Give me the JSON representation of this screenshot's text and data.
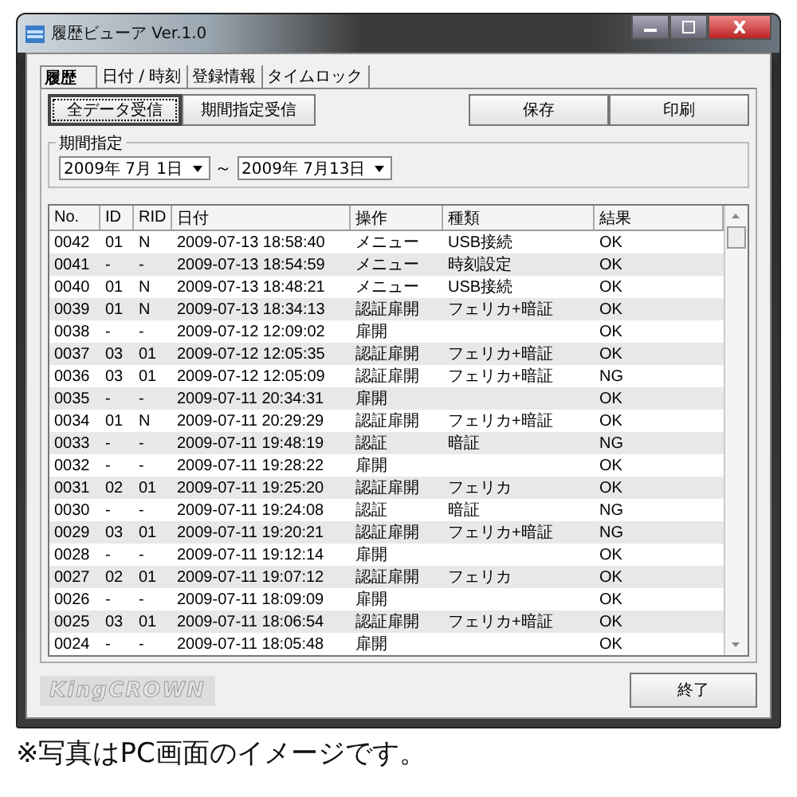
{
  "window": {
    "title": "履歴ビューア Ver.1.0"
  },
  "tabs": [
    {
      "label": "履歴",
      "selected": true
    },
    {
      "label": "日付 / 時刻",
      "selected": false
    },
    {
      "label": "登録情報",
      "selected": false
    },
    {
      "label": "タイムロック",
      "selected": false
    }
  ],
  "buttons": [
    {
      "label": "全データ受信",
      "selected": true
    },
    {
      "label": "期間指定受信",
      "selected": false
    },
    {
      "label": "保存",
      "selected": false
    },
    {
      "label": "印刷",
      "selected": false
    }
  ],
  "period": {
    "label": "期間指定",
    "from": "2009年 7月 1日",
    "separator": "～",
    "to": "2009年 7月13日"
  },
  "table": {
    "columns": [
      "No.",
      "ID",
      "RID",
      "日付",
      "操作",
      "種類",
      "結果"
    ],
    "rows": [
      {
        "no": "0042",
        "id": "01",
        "rid": "N",
        "date": "2009-07-13 18:58:40",
        "op": "メニュー",
        "type": "USB接続",
        "result": "OK"
      },
      {
        "no": "0041",
        "id": "-",
        "rid": "-",
        "date": "2009-07-13 18:54:59",
        "op": "メニュー",
        "type": "時刻設定",
        "result": "OK"
      },
      {
        "no": "0040",
        "id": "01",
        "rid": "N",
        "date": "2009-07-13 18:48:21",
        "op": "メニュー",
        "type": "USB接続",
        "result": "OK"
      },
      {
        "no": "0039",
        "id": "01",
        "rid": "N",
        "date": "2009-07-13 18:34:13",
        "op": "認証扉開",
        "type": "フェリカ+暗証",
        "result": "OK"
      },
      {
        "no": "0038",
        "id": "-",
        "rid": "-",
        "date": "2009-07-12 12:09:02",
        "op": "扉開",
        "result": "OK"
      },
      {
        "no": "0037",
        "id": "03",
        "rid": "01",
        "date": "2009-07-12 12:05:35",
        "op": "認証扉開",
        "type": "フェリカ+暗証",
        "result": "OK"
      },
      {
        "no": "0036",
        "id": "03",
        "rid": "01",
        "date": "2009-07-12 12:05:09",
        "op": "認証扉開",
        "type": "フェリカ+暗証",
        "result": "NG"
      },
      {
        "no": "0035",
        "id": "-",
        "rid": "-",
        "date": "2009-07-11 20:34:31",
        "op": "扉開",
        "result": "OK"
      },
      {
        "no": "0034",
        "id": "01",
        "rid": "N",
        "date": "2009-07-11 20:29:29",
        "op": "認証扉開",
        "type": "フェリカ+暗証",
        "result": "OK"
      },
      {
        "no": "0033",
        "id": "-",
        "rid": "-",
        "date": "2009-07-11 19:48:19",
        "op": "認証",
        "type": "暗証",
        "result": "NG"
      },
      {
        "no": "0032",
        "id": "-",
        "rid": "-",
        "date": "2009-07-11 19:28:22",
        "op": "扉開",
        "result": "OK"
      },
      {
        "no": "0031",
        "id": "02",
        "rid": "01",
        "date": "2009-07-11 19:25:20",
        "op": "認証扉開",
        "type": "フェリカ",
        "result": "OK"
      },
      {
        "no": "0030",
        "id": "-",
        "rid": "-",
        "date": "2009-07-11 19:24:08",
        "op": "認証",
        "type": "暗証",
        "result": "NG"
      },
      {
        "no": "0029",
        "id": "03",
        "rid": "01",
        "date": "2009-07-11 19:20:21",
        "op": "認証扉開",
        "type": "フェリカ+暗証",
        "result": "NG"
      },
      {
        "no": "0028",
        "id": "-",
        "rid": "-",
        "date": "2009-07-11 19:12:14",
        "op": "扉開",
        "result": "OK"
      },
      {
        "no": "0027",
        "id": "02",
        "rid": "01",
        "date": "2009-07-11 19:07:12",
        "op": "認証扉開",
        "type": "フェリカ",
        "result": "OK"
      },
      {
        "no": "0026",
        "id": "-",
        "rid": "-",
        "date": "2009-07-11 18:09:09",
        "op": "扉開",
        "result": "OK"
      },
      {
        "no": "0025",
        "id": "03",
        "rid": "01",
        "date": "2009-07-11 18:06:54",
        "op": "認証扉開",
        "type": "フェリカ+暗証",
        "result": "OK"
      },
      {
        "no": "0024",
        "id": "-",
        "rid": "-",
        "date": "2009-07-11 18:05:48",
        "op": "扉開",
        "result": "OK"
      }
    ]
  },
  "logo": "KingCROWN",
  "close_button": "終了",
  "caption": "※写真はPC画面のイメージです。"
}
